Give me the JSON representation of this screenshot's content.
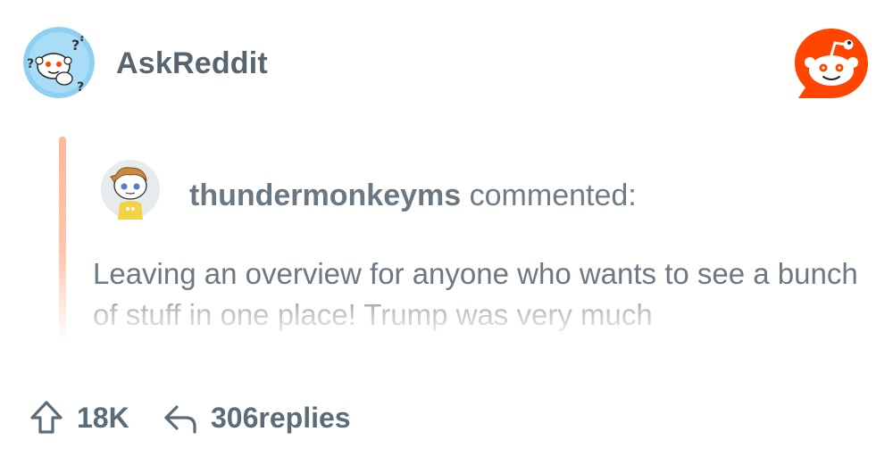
{
  "header": {
    "subreddit": "AskReddit",
    "subreddit_icon": "askreddit-snoo-question-marks",
    "brand_icon": "reddit-logo"
  },
  "comment": {
    "username": "thundermonkeyms",
    "action": "commented:",
    "avatar_icon": "user-snoo-avatar",
    "text": "Leaving an overview for anyone who wants to see a bunch of stuff in one place! Trump was very much"
  },
  "footer": {
    "upvote_icon": "upvote-arrow-icon",
    "upvotes": "18K",
    "reply_icon": "reply-arrow-icon",
    "replies": "306replies"
  },
  "colors": {
    "brand_orange": "#ff4500",
    "quote_bar": "#ffb89c",
    "text_gray": "#5b6b78",
    "subreddit_icon_bg": "#7ec8ef"
  }
}
